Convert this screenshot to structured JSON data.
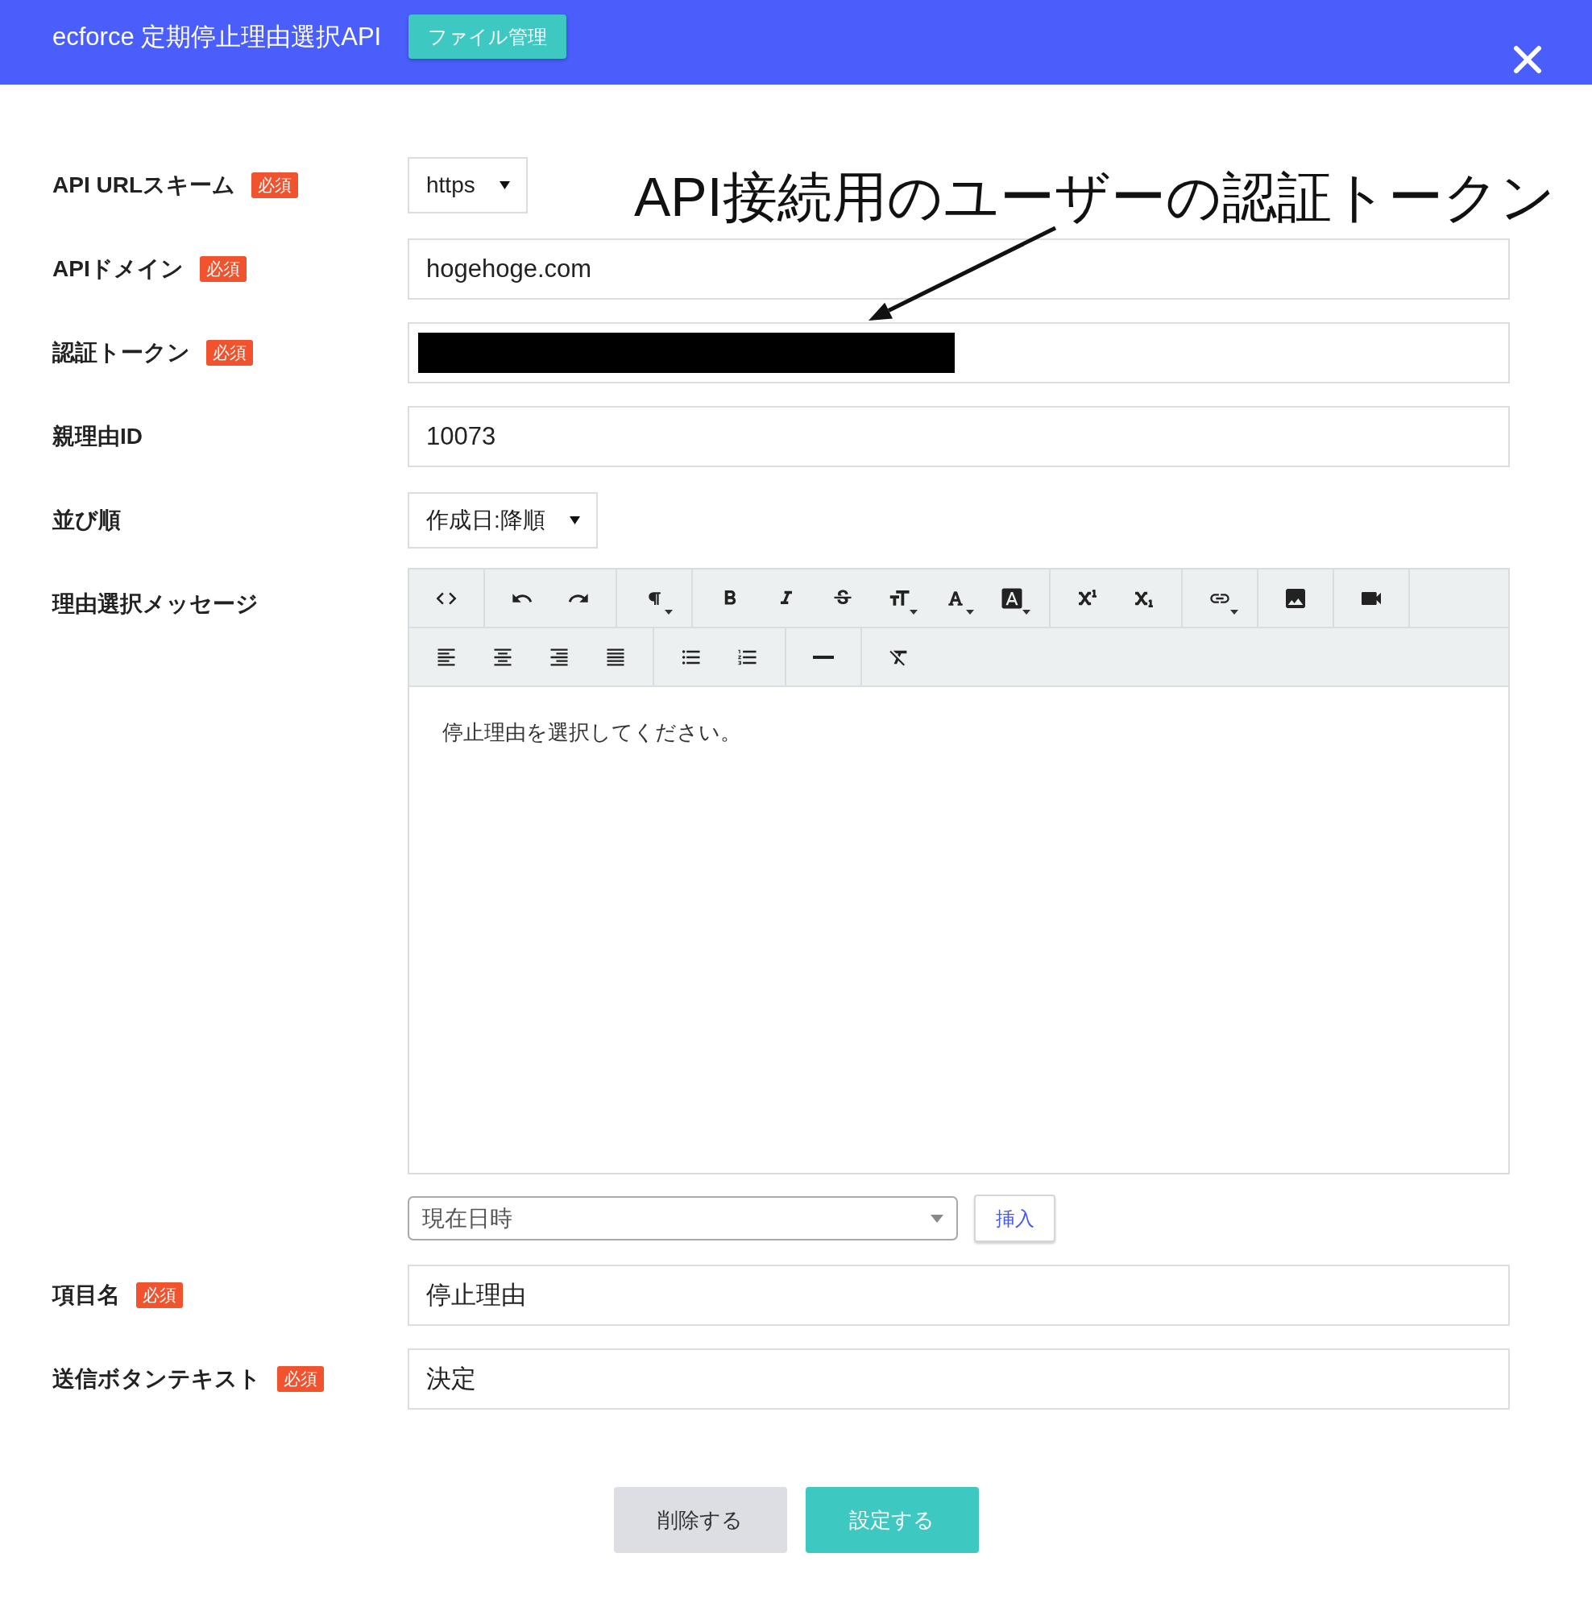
{
  "header": {
    "title": "ecforce 定期停止理由選択API",
    "file_button": "ファイル管理"
  },
  "annotation": {
    "text": "API接続用のユーザーの認証トークン"
  },
  "fields": [
    {
      "label": "API URLスキーム",
      "badge": "必須",
      "kind": "select",
      "value": "https"
    },
    {
      "label": "APIドメイン",
      "badge": "必須",
      "kind": "text",
      "value": "hogehoge.com"
    },
    {
      "label": "認証トークン",
      "badge": "必須",
      "kind": "redacted"
    },
    {
      "label": "親理由ID",
      "kind": "text",
      "value": "10073"
    },
    {
      "label": "並び順",
      "kind": "select",
      "value": "作成日:降順"
    },
    {
      "label": "理由選択メッセージ",
      "kind": "editor",
      "content": "停止理由を選択してください。",
      "variable": "現在日時",
      "insert_button": "挿入"
    },
    {
      "label": "項目名",
      "badge": "必須",
      "kind": "text",
      "value": "停止理由"
    },
    {
      "label": "送信ボタンテキスト",
      "badge": "必須",
      "kind": "text",
      "value": "決定"
    }
  ],
  "buttons": [
    {
      "label": "削除する",
      "kind": "delete"
    },
    {
      "label": "設定する",
      "kind": "save"
    }
  ]
}
